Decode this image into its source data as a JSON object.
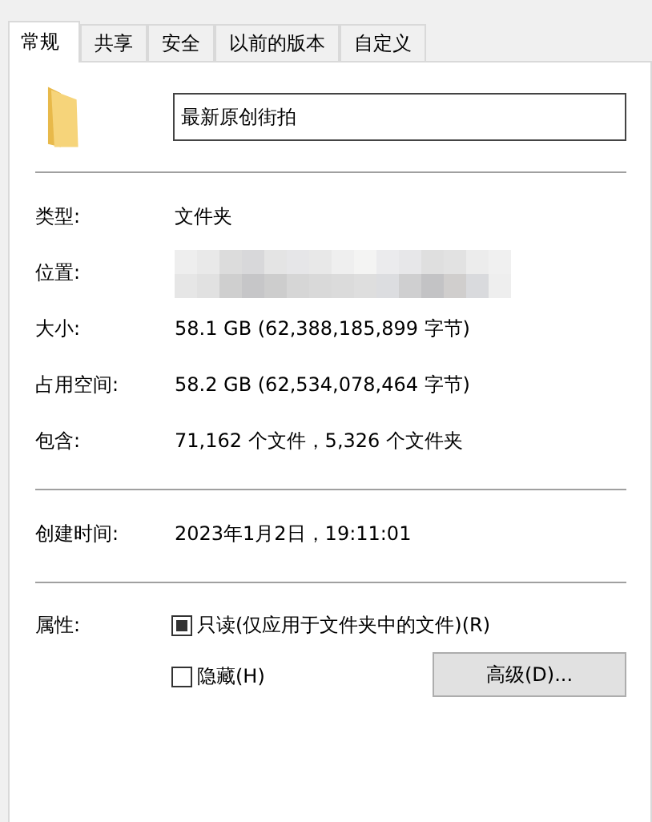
{
  "tabs": [
    {
      "label": "常规",
      "selected": true
    },
    {
      "label": "共享",
      "selected": false
    },
    {
      "label": "安全",
      "selected": false
    },
    {
      "label": "以前的版本",
      "selected": false
    },
    {
      "label": "自定义",
      "selected": false
    }
  ],
  "name_field": {
    "value": "最新原创街拍"
  },
  "groups": [
    {
      "rows": [
        {
          "label": "类型:",
          "value": "文件夹"
        },
        {
          "label": "位置:",
          "kind": "redacted"
        },
        {
          "label": "大小:",
          "value": "58.1 GB (62,388,185,899 字节)"
        },
        {
          "label": "占用空间:",
          "value": "58.2 GB (62,534,078,464 字节)"
        },
        {
          "label": "包含:",
          "value": "71,162 个文件，5,326 个文件夹"
        }
      ]
    },
    {
      "rows": [
        {
          "label": "创建时间:",
          "value": "2023年1月2日，19:11:01"
        }
      ]
    }
  ],
  "attributes": {
    "label": "属性:",
    "checkboxes": [
      {
        "label": "只读(仅应用于文件夹中的文件)(R)",
        "checked": false,
        "indeterminate": true
      },
      {
        "label": "隐藏(H)",
        "checked": false,
        "indeterminate": false
      }
    ],
    "button": "高级(D)..."
  }
}
